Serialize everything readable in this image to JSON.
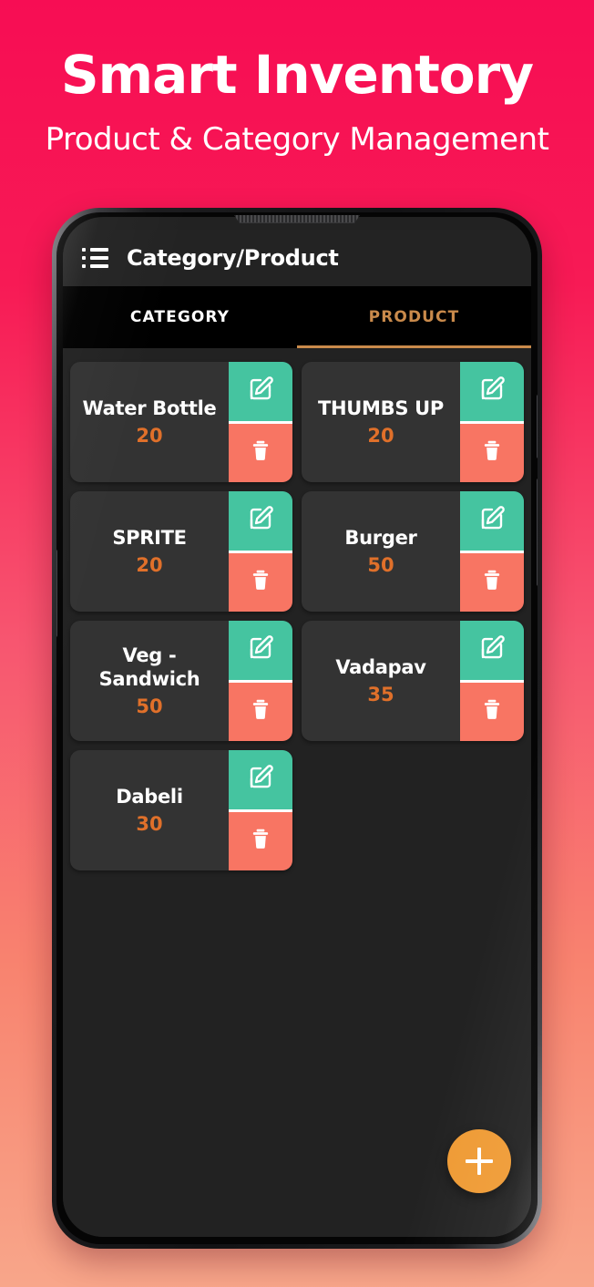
{
  "promo": {
    "title": "Smart Inventory",
    "subtitle": "Product & Category Management"
  },
  "colors": {
    "bg_top": "#f70d54",
    "bg_mid": "#f75670",
    "bg_bottom": "#f8a68a",
    "screen_bg": "#222222",
    "card_bg": "#333333",
    "edit_green": "#45c4a0",
    "delete_coral": "#f87563",
    "qty_orange": "#e0702a",
    "tab_active": "#c98a4b",
    "fab_orange": "#ef9b35"
  },
  "appbar": {
    "menu_icon": "list-icon",
    "title": "Category/Product"
  },
  "tabs": [
    {
      "label": "CATEGORY",
      "active": false
    },
    {
      "label": "PRODUCT",
      "active": true
    }
  ],
  "products": [
    {
      "name": "Water Bottle",
      "qty": "20",
      "edit_icon": "edit-square-pencil-icon",
      "delete_icon": "trash-icon"
    },
    {
      "name": "THUMBS UP",
      "qty": "20",
      "edit_icon": "edit-square-pencil-icon",
      "delete_icon": "trash-icon"
    },
    {
      "name": "SPRITE",
      "qty": "20",
      "edit_icon": "edit-square-pencil-icon",
      "delete_icon": "trash-icon"
    },
    {
      "name": "Burger",
      "qty": "50",
      "edit_icon": "edit-square-pencil-icon",
      "delete_icon": "trash-icon"
    },
    {
      "name": "Veg - Sandwich",
      "qty": "50",
      "edit_icon": "edit-square-pencil-icon",
      "delete_icon": "trash-icon"
    },
    {
      "name": "Vadapav",
      "qty": "35",
      "edit_icon": "edit-square-pencil-icon",
      "delete_icon": "trash-icon"
    },
    {
      "name": "Dabeli",
      "qty": "30",
      "edit_icon": "edit-square-pencil-icon",
      "delete_icon": "trash-icon"
    }
  ],
  "fab": {
    "icon": "plus-icon",
    "label": "+"
  }
}
